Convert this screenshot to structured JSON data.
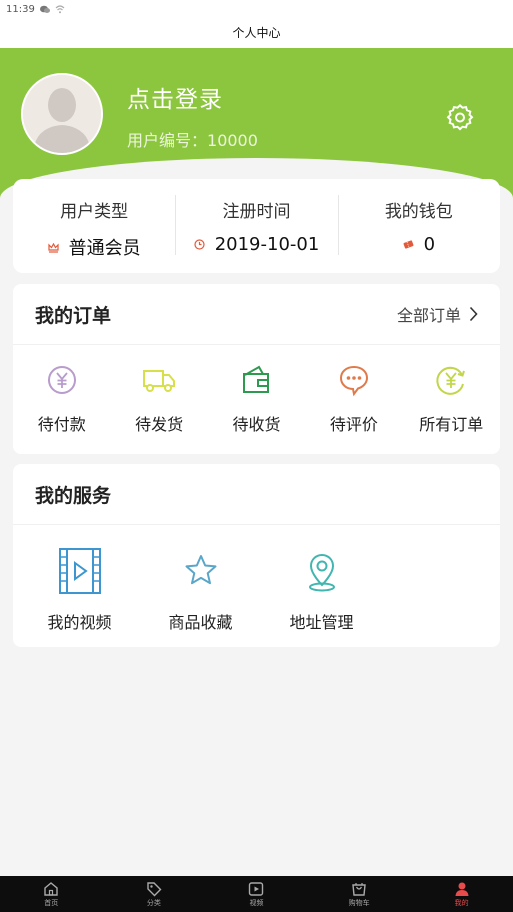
{
  "status_bar": {
    "time": "11:39"
  },
  "page_title": "个人中心",
  "profile": {
    "login_text": "点击登录",
    "user_no_label": "用户编号：",
    "user_no": "10000"
  },
  "info": {
    "user_type_label": "用户类型",
    "user_type_value": "普通会员",
    "register_label": "注册时间",
    "register_value": "2019-10-01",
    "wallet_label": "我的钱包",
    "wallet_value": "0"
  },
  "orders": {
    "title": "我的订单",
    "all_label": "全部订单",
    "items": [
      {
        "label": "待付款",
        "icon": "yen-circle-icon",
        "color": "#b79ccc"
      },
      {
        "label": "待发货",
        "icon": "truck-icon",
        "color": "#d7e04b"
      },
      {
        "label": "待收货",
        "icon": "wallet-icon",
        "color": "#2e9a4f"
      },
      {
        "label": "待评价",
        "icon": "chat-bubble-icon",
        "color": "#e07a4a"
      },
      {
        "label": "所有订单",
        "icon": "yen-refresh-icon",
        "color": "#c3d64a"
      }
    ]
  },
  "services": {
    "title": "我的服务",
    "items": [
      {
        "label": "我的视频",
        "icon": "video-film-icon",
        "color": "#3d96cf"
      },
      {
        "label": "商品收藏",
        "icon": "star-icon",
        "color": "#5aa6c9"
      },
      {
        "label": "地址管理",
        "icon": "location-pin-icon",
        "color": "#41b6b0"
      }
    ]
  },
  "tabs": [
    {
      "label": "首页",
      "icon": "home-icon"
    },
    {
      "label": "分类",
      "icon": "tag-icon"
    },
    {
      "label": "视频",
      "icon": "play-icon"
    },
    {
      "label": "购物车",
      "icon": "cart-icon"
    },
    {
      "label": "我的",
      "icon": "person-icon",
      "active": true
    }
  ],
  "colors": {
    "header_green": "#8cc63f",
    "active_tab": "#e84b4b"
  }
}
